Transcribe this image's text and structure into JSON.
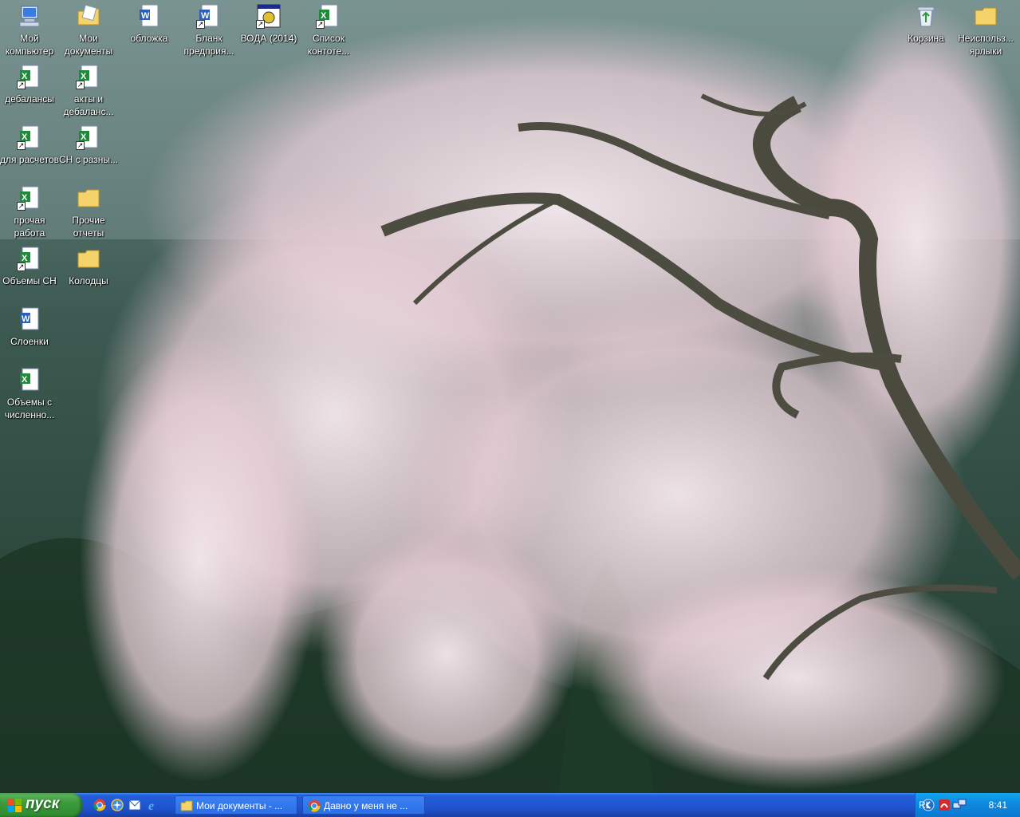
{
  "desktop": {
    "icons": [
      {
        "label": "Мой компьютер",
        "icon": "my-computer-icon"
      },
      {
        "label": "Мои документы",
        "icon": "my-documents-icon"
      },
      {
        "label": "обложка",
        "icon": "word-document-icon"
      },
      {
        "label": "Бланк предприя...",
        "icon": "word-document-icon"
      },
      {
        "label": "ВОДА (2014)",
        "icon": "program-shortcut-icon"
      },
      {
        "label": "Список контоте...",
        "icon": "excel-document-icon"
      },
      {
        "label": "Корзина",
        "icon": "recycle-bin-icon"
      },
      {
        "label": "Неиспольз... ярлыки",
        "icon": "folder-icon"
      },
      {
        "label": "дебалансы",
        "icon": "excel-shortcut-icon"
      },
      {
        "label": "акты и дебаланс...",
        "icon": "excel-shortcut-icon"
      },
      {
        "label": "для расчетов",
        "icon": "excel-shortcut-icon"
      },
      {
        "label": "СН с разны...",
        "icon": "excel-shortcut-icon"
      },
      {
        "label": "прочая работа",
        "icon": "excel-shortcut-icon"
      },
      {
        "label": "Прочие отчеты",
        "icon": "folder-icon"
      },
      {
        "label": "Объемы СН",
        "icon": "excel-shortcut-icon"
      },
      {
        "label": "Колодцы",
        "icon": "folder-icon"
      },
      {
        "label": "Слоенки",
        "icon": "word-document-icon"
      },
      {
        "label": "Объемы с численно...",
        "icon": "excel-document-icon"
      }
    ]
  },
  "taskbar": {
    "start_label": "пуск",
    "quick_launch": [
      "chrome-icon",
      "browser-icon",
      "outlook-icon",
      "ie-icon"
    ],
    "tasks": [
      {
        "label": "Мои документы - ...",
        "icon": "folder-icon"
      },
      {
        "label": "Давно у меня не ...",
        "icon": "chrome-icon"
      }
    ],
    "tray": {
      "language": "RL",
      "clock": "8:41",
      "icons": [
        "chevron-left-icon",
        "antivirus-icon",
        "network-icon"
      ]
    }
  },
  "colors": {
    "taskbar": "#245edb",
    "start": "#3c9a3d",
    "tray": "#0e8be0"
  }
}
